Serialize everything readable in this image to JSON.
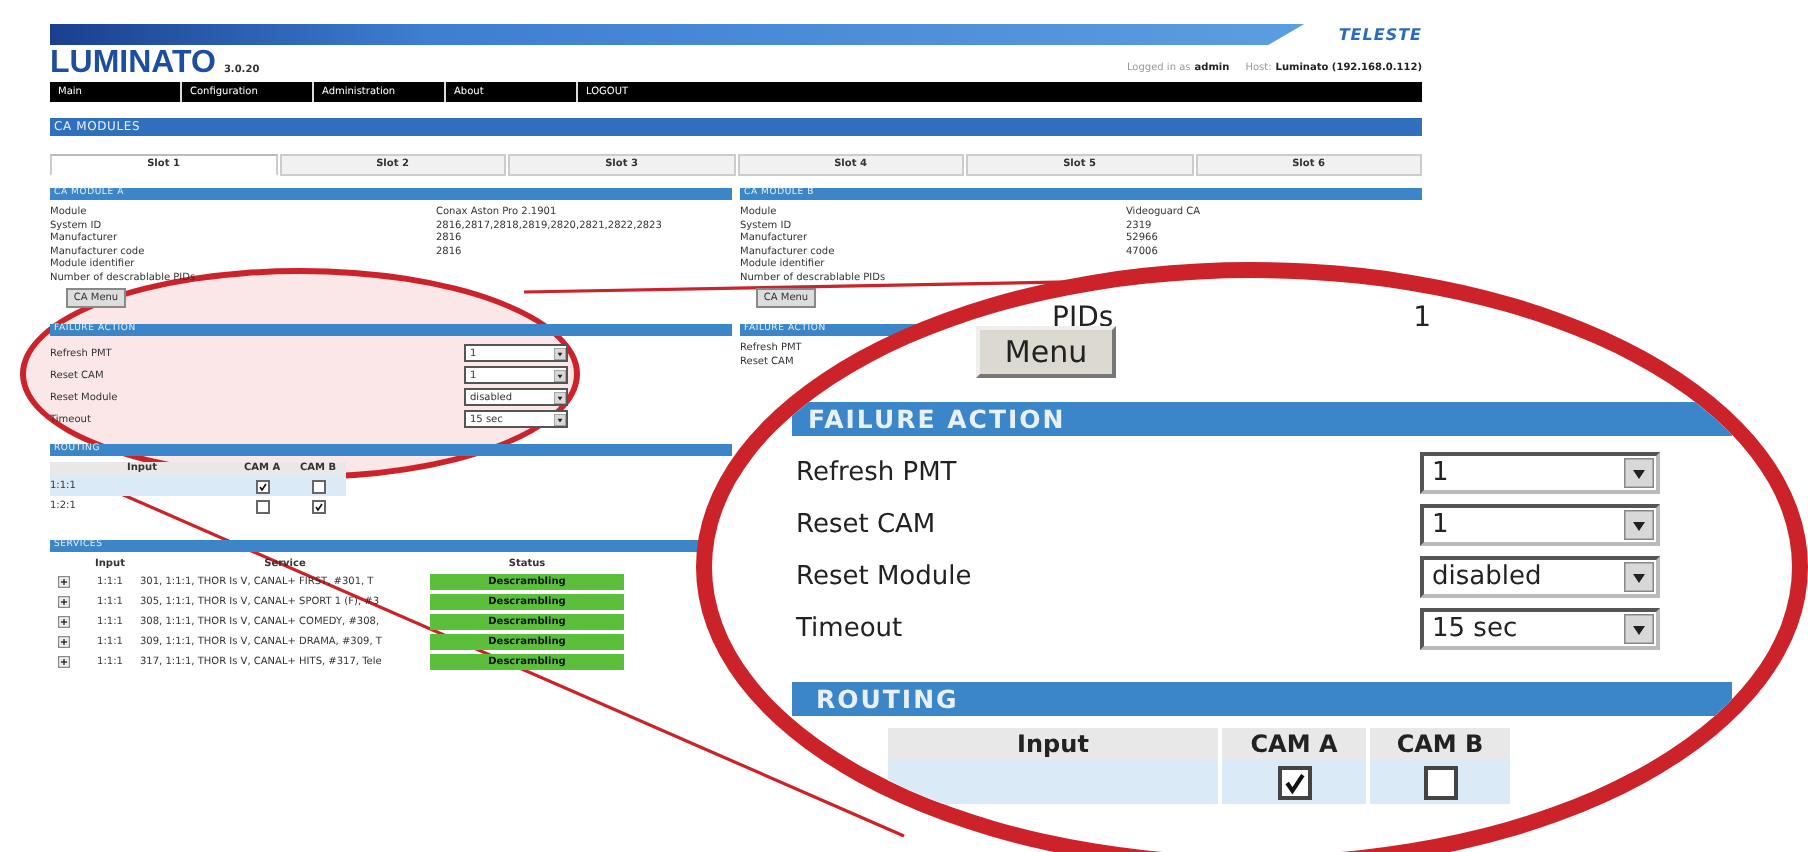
{
  "header": {
    "logo": "TELESTE",
    "product": "LUMINATO",
    "version": "3.0.20",
    "login_label": "Logged in as",
    "user": "admin",
    "host_label": "Host:",
    "host": "Luminato (192.168.0.112)"
  },
  "nav": [
    "Main",
    "Configuration",
    "Administration",
    "About",
    "LOGOUT"
  ],
  "section_title": "CA MODULES",
  "tabs": [
    {
      "label": "Slot 1",
      "selected": true
    },
    {
      "label": "Slot 2",
      "selected": false
    },
    {
      "label": "Slot 3",
      "selected": false
    },
    {
      "label": "Slot 4",
      "selected": false
    },
    {
      "label": "Slot 5",
      "selected": false
    },
    {
      "label": "Slot 6",
      "selected": false
    }
  ],
  "module_a": {
    "title": "CA MODULE A",
    "fields": [
      {
        "label": "Module",
        "value": "Conax Aston Pro 2.1901"
      },
      {
        "label": "System ID",
        "value": "2816,2817,2818,2819,2820,2821,2822,2823"
      },
      {
        "label": "Manufacturer",
        "value": "2816"
      },
      {
        "label": "Manufacturer code",
        "value": "2816"
      },
      {
        "label": "Module identifier"
      },
      {
        "label": "Number of descrablable PIDs"
      }
    ],
    "button": "CA Menu"
  },
  "failure_action": {
    "title": "FAILURE ACTION",
    "fields": [
      {
        "label": "Refresh PMT",
        "value": "1"
      },
      {
        "label": "Reset CAM",
        "value": "1"
      },
      {
        "label": "Reset Module",
        "value": "disabled"
      },
      {
        "label": "Timeout",
        "value": "15 sec"
      }
    ]
  },
  "routing": {
    "title": "ROUTING",
    "columns": [
      "Input",
      "CAM A",
      "CAM B"
    ],
    "rows": [
      {
        "input": "1:1:1",
        "cam_a": true,
        "cam_b": false,
        "selected": true
      },
      {
        "input": "1:2:1",
        "cam_a": false,
        "cam_b": true,
        "selected": false
      }
    ]
  },
  "services": {
    "title": "SERVICES",
    "columns": [
      "Input",
      "Service",
      "Status"
    ],
    "rows": [
      {
        "input": "1:1:1",
        "service": "301, 1:1:1, THOR Is V, CANAL+ FIRST, #301, T",
        "status": "Descrambling"
      },
      {
        "input": "1:1:1",
        "service": "305, 1:1:1, THOR Is V, CANAL+ SPORT 1 (F), #3",
        "status": "Descrambling"
      },
      {
        "input": "1:1:1",
        "service": "308, 1:1:1, THOR Is V, CANAL+ COMEDY, #308,",
        "status": "Descrambling"
      },
      {
        "input": "1:1:1",
        "service": "309, 1:1:1, THOR Is V, CANAL+ DRAMA, #309, T",
        "status": "Descrambling"
      },
      {
        "input": "1:1:1",
        "service": "317, 1:1:1, THOR Is V, CANAL+ HITS, #317, Tele",
        "status": "Descrambling"
      }
    ]
  },
  "module_b": {
    "title": "CA MODULE B",
    "fields": [
      {
        "label": "Module",
        "value": "Videoguard CA"
      },
      {
        "label": "System ID",
        "value": "2319"
      },
      {
        "label": "Manufacturer",
        "value": "52966"
      },
      {
        "label": "Manufacturer code",
        "value": "47006"
      },
      {
        "label": "Module identifier"
      },
      {
        "label": "Number of descrablable PIDs"
      }
    ],
    "button": "CA Menu",
    "failure_title": "FAILURE ACTION",
    "failure_labels": [
      "Refresh PMT",
      "Reset CAM"
    ]
  },
  "callout": {
    "pids_label": "PIDs",
    "pids_value": "1",
    "button": "Menu",
    "failure_title": "FAILURE ACTION",
    "fields": [
      {
        "label": "Refresh PMT",
        "value": "1"
      },
      {
        "label": "Reset CAM",
        "value": "1"
      },
      {
        "label": "Reset Module",
        "value": "disabled"
      },
      {
        "label": "Timeout",
        "value": "15 sec"
      }
    ],
    "routing_title": "ROUTING",
    "columns": [
      "Input",
      "CAM A",
      "CAM B"
    ],
    "row": {
      "cam_a": true,
      "cam_b": false,
      "selected": true
    }
  }
}
